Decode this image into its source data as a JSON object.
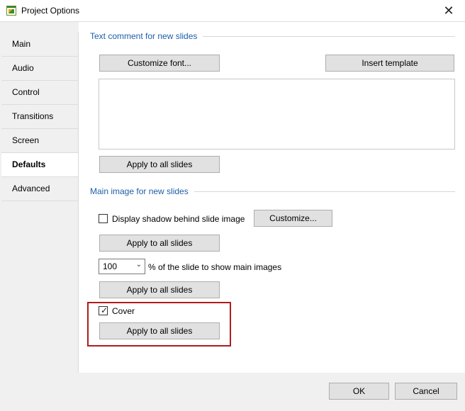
{
  "window": {
    "title": "Project Options",
    "icon": "project-options-app-icon",
    "close_glyph": "✕"
  },
  "sidebar": {
    "items": [
      {
        "label": "Main"
      },
      {
        "label": "Audio"
      },
      {
        "label": "Control"
      },
      {
        "label": "Transitions"
      },
      {
        "label": "Screen"
      },
      {
        "label": "Defaults",
        "selected": true
      },
      {
        "label": "Advanced"
      }
    ]
  },
  "text_comment": {
    "section_title": "Text comment for new slides",
    "customize_font_label": "Customize font...",
    "insert_template_label": "Insert template",
    "memo_value": "",
    "apply_label": "Apply to all slides"
  },
  "main_image": {
    "section_title": "Main image for new slides",
    "shadow_label": "Display shadow behind slide image",
    "shadow_checked": false,
    "customize_label": "Customize...",
    "apply_shadow_label": "Apply to all slides",
    "percent_value": "100",
    "percent_label": "% of the slide to show main images",
    "apply_percent_label": "Apply to all slides",
    "cover_label": "Cover",
    "cover_checked": true,
    "apply_cover_label": "Apply to all slides"
  },
  "footer": {
    "ok_label": "OK",
    "cancel_label": "Cancel"
  },
  "colors": {
    "section_title": "#1e5fa8",
    "highlight_border": "#b01c1c"
  }
}
